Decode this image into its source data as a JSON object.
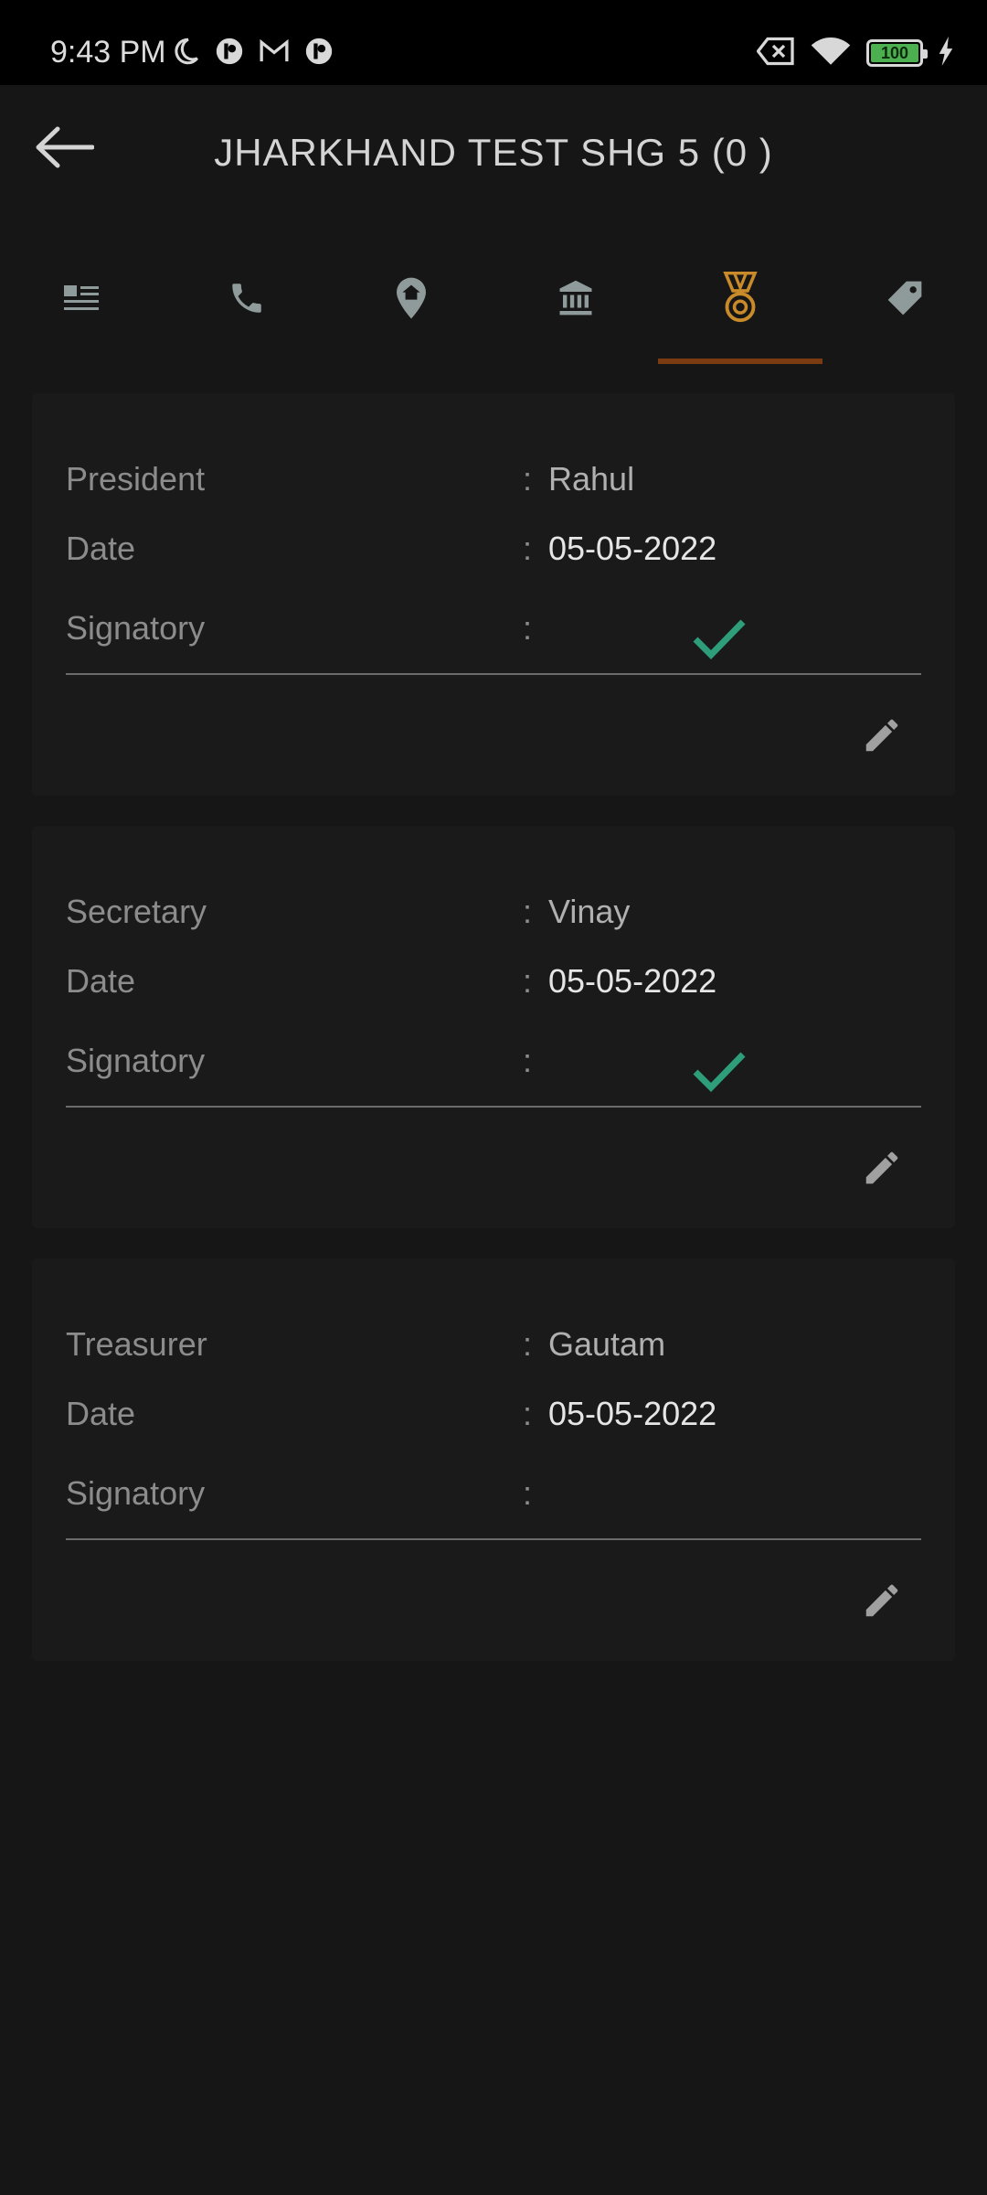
{
  "status_bar": {
    "time": "9:43 PM",
    "left_icons": [
      "moon-icon",
      "app-notification-icon",
      "gmail-icon",
      "app-notification-icon"
    ],
    "right_icons": [
      "sim-off-icon",
      "wifi-icon",
      "battery-icon",
      "charging-icon"
    ],
    "battery_level": "100"
  },
  "app_bar": {
    "title": "JHARKHAND TEST SHG 5 (0 )",
    "back_icon": "back-arrow-icon"
  },
  "tabs": [
    {
      "icon": "details-icon",
      "selected": false
    },
    {
      "icon": "phone-icon",
      "selected": false
    },
    {
      "icon": "location-icon",
      "selected": false
    },
    {
      "icon": "bank-icon",
      "selected": false
    },
    {
      "icon": "medal-icon",
      "selected": true
    },
    {
      "icon": "tag-icon",
      "selected": false
    }
  ],
  "colors": {
    "accent": "#c98a2a",
    "indicator": "#7a3b10",
    "check": "#2e9e7a"
  },
  "cards": [
    {
      "role_label": "President",
      "role_value": "Rahul",
      "date_label": "Date",
      "date_value": "05-05-2022",
      "signatory_label": "Signatory",
      "signed": true,
      "separator": ":"
    },
    {
      "role_label": "Secretary",
      "role_value": "Vinay",
      "date_label": "Date",
      "date_value": "05-05-2022",
      "signatory_label": "Signatory",
      "signed": true,
      "separator": ":"
    },
    {
      "role_label": "Treasurer",
      "role_value": "Gautam",
      "date_label": "Date",
      "date_value": "05-05-2022",
      "signatory_label": "Signatory",
      "signed": false,
      "separator": ":"
    }
  ]
}
